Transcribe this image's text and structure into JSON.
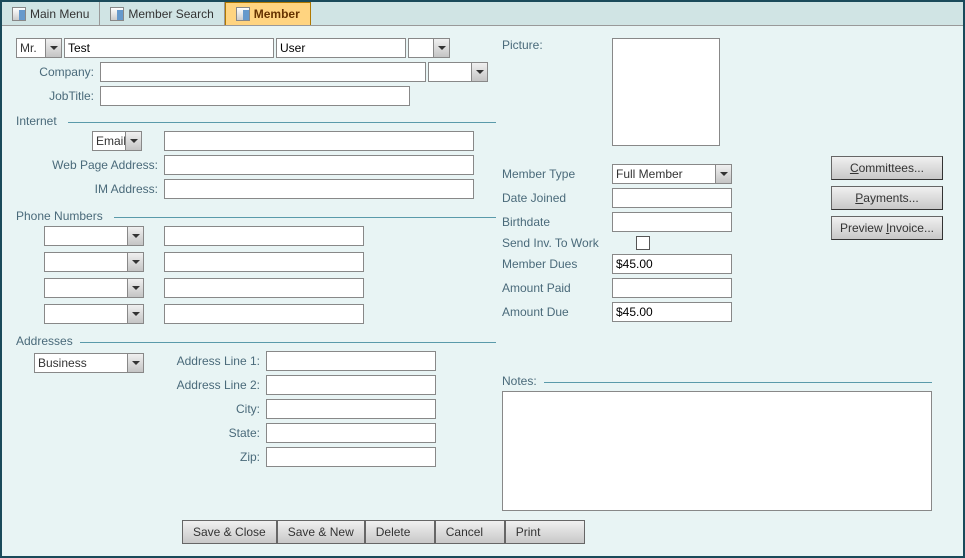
{
  "tabs": {
    "main": "Main Menu",
    "search": "Member Search",
    "member": "Member"
  },
  "name": {
    "title": "Mr.",
    "first": "Test",
    "last": "User"
  },
  "labels": {
    "company": "Company:",
    "jobtitle": "JobTitle:",
    "internet": "Internet",
    "email": "Email",
    "webpage": "Web Page Address:",
    "im": "IM Address:",
    "phones": "Phone Numbers",
    "addresses": "Addresses",
    "addr1": "Address Line 1:",
    "addr2": "Address Line 2:",
    "city": "City:",
    "state": "State:",
    "zip": "Zip:",
    "picture": "Picture:",
    "memtype": "Member Type",
    "datejoined": "Date Joined",
    "birthdate": "Birthdate",
    "sendinv": "Send Inv. To Work",
    "dues": "Member Dues",
    "paid": "Amount Paid",
    "due": "Amount Due",
    "notes": "Notes:"
  },
  "values": {
    "memtype": "Full Member",
    "dues": "$45.00",
    "due": "$45.00",
    "addrtype": "Business",
    "company": "",
    "jobtitle": "",
    "email": "",
    "webpage": "",
    "im": "",
    "datejoined": "",
    "birthdate": "",
    "paid": "",
    "addr1": "",
    "addr2": "",
    "city": "",
    "state": "",
    "zip": ""
  },
  "buttons": {
    "committees": "Committees...",
    "payments": "Payments...",
    "preview": "Preview Invoice...",
    "saveclose": "Save & Close",
    "savenew": "Save & New",
    "delete": "Delete",
    "cancel": "Cancel",
    "print": "Print"
  }
}
